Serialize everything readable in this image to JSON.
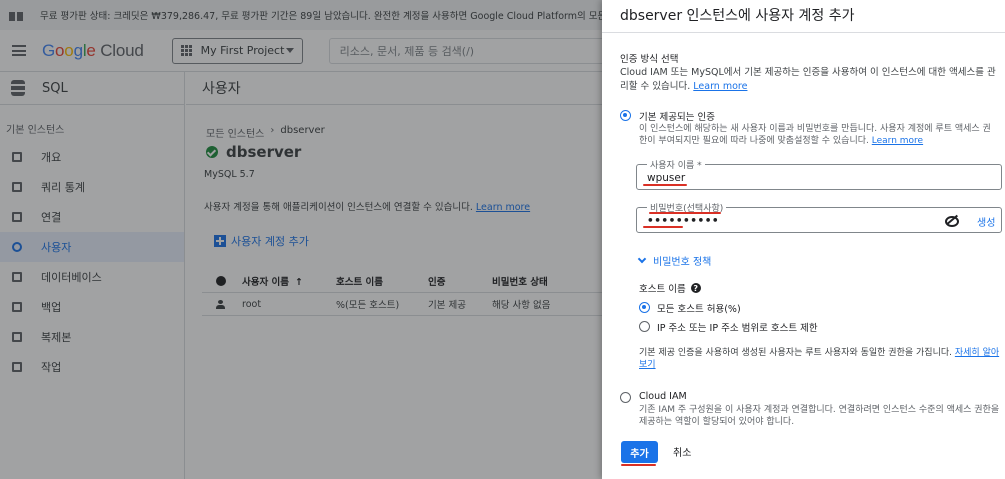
{
  "banner": {
    "text": "무료 평가판 상태: 크레딧은 ₩379,286.47, 무료 평가판 기간은 89일 남았습니다. 완전한 계정을 사용하면 Google Cloud Platform의 모든 기능에"
  },
  "topbar": {
    "logo": {
      "g1": "G",
      "g2": "o",
      "g3": "o",
      "g4": "g",
      "g5": "l",
      "g6": "e",
      "cloud": " Cloud"
    },
    "project_label": "My First Project",
    "search_placeholder": "리소스, 문서, 제품 등 검색(/)"
  },
  "sidebar": {
    "title": "SQL",
    "section": "기본 인스턴스",
    "items": [
      {
        "label": "개요",
        "icon": "overview-icon"
      },
      {
        "label": "쿼리 통계",
        "icon": "query-stats-icon"
      },
      {
        "label": "연결",
        "icon": "connections-icon"
      },
      {
        "label": "사용자",
        "icon": "users-icon"
      },
      {
        "label": "데이터베이스",
        "icon": "databases-icon"
      },
      {
        "label": "백업",
        "icon": "backups-icon"
      },
      {
        "label": "복제본",
        "icon": "replicas-icon"
      },
      {
        "label": "작업",
        "icon": "operations-icon"
      }
    ],
    "active_index": 3
  },
  "main": {
    "header": "사용자",
    "breadcrumb": {
      "root": "모든 인스턴스",
      "sep": "›",
      "current": "dbserver"
    },
    "instance_name": "dbserver",
    "version": "MySQL 5.7",
    "description": "사용자 계정을 통해 애플리케이션이 인스턴스에 연결할 수 있습니다.",
    "learn_more": "Learn more",
    "add_user_label": "사용자 계정 추가",
    "table": {
      "headers": [
        "사용자 이름",
        "호스트 이름",
        "인증",
        "비밀번호 상태"
      ],
      "sort_arrow": "↑",
      "rows": [
        {
          "user": "root",
          "host": "%(모든 호스트)",
          "auth": "기본 제공",
          "pw_status": "해당 사항 없음"
        }
      ]
    }
  },
  "panel": {
    "title": "dbserver 인스턴스에 사용자 계정 추가",
    "auth_title": "인증 방식 선택",
    "auth_desc": "Cloud IAM 또는 MySQL에서 기본 제공하는 인증을 사용하여 이 인스턴스에 대한 액세스를 관리할 수 있습니다.",
    "learn_more": "Learn more",
    "builtin": {
      "label": "기본 제공되는 인증",
      "desc": "이 인스턴스에 해당하는 새 사용자 이름과 비밀번호를 만듭니다. 사용자 계정에 루트 액세스 권한이 부여되지만 필요에 따라 나중에 맞춤설정할 수 있습니다.",
      "learn_more": "Learn more",
      "selected": true
    },
    "username": {
      "label": "사용자 이름 *",
      "value": "wpuser"
    },
    "password": {
      "label": "비밀번호(선택사항)",
      "value": "••••••••••",
      "generate": "생성"
    },
    "password_policy": "비밀번호 정책",
    "host": {
      "title": "호스트 이름",
      "help": "?",
      "options": [
        {
          "label": "모든 호스트 허용(%)",
          "selected": true
        },
        {
          "label": "IP 주소 또는 IP 주소 범위로 호스트 제한",
          "selected": false
        }
      ],
      "note": "기본 제공 인증을 사용하여 생성된 사용자는 루트 사용자와 동일한 권한을 가집니다.",
      "note_link": "자세히 알아보기"
    },
    "iam": {
      "label": "Cloud IAM",
      "desc": "기존 IAM 주 구성원을 이 사용자 계정과 연결합니다. 연결하려면 인스턴스 수준의 액세스 권한을 제공하는 역할이 할당되어 있어야 합니다.",
      "selected": false
    },
    "add_button": "추가",
    "cancel_button": "취소"
  },
  "colors": {
    "accent": "#1a73e8",
    "annotation": "#d93025",
    "success": "#1e8e3e"
  }
}
